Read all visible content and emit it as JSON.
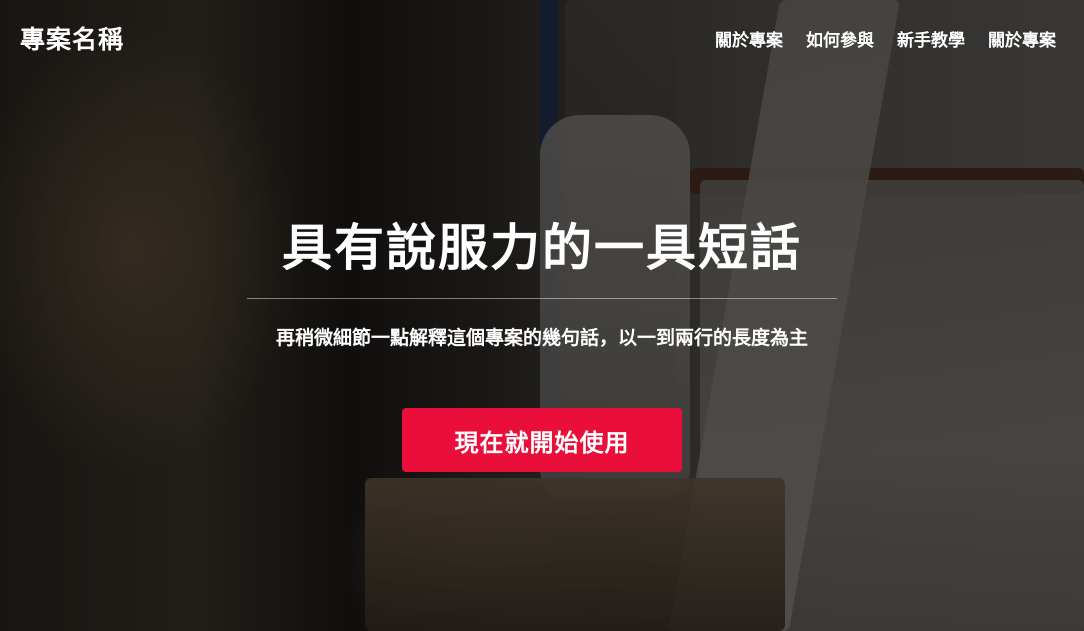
{
  "nav": {
    "brand": "專案名稱",
    "links": [
      "關於專案",
      "如何參與",
      "新手教學",
      "關於專案"
    ]
  },
  "hero": {
    "title": "具有說服力的一具短話",
    "subtitle": "再稍微細節一點解釋這個專案的幾句話，以一到兩行的長度為主",
    "cta_label": "現在就開始使用"
  },
  "colors": {
    "accent": "#ea0e3b",
    "text": "#ffffff"
  }
}
